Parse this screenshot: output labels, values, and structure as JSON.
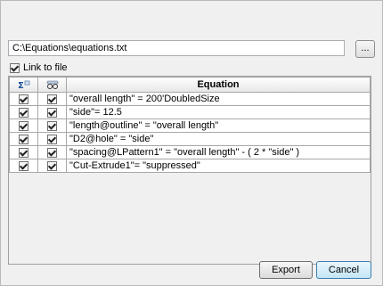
{
  "file": {
    "path": "C:\\Equations\\equations.txt",
    "browse_label": "...",
    "link_label": "Link to file",
    "link_checked": true
  },
  "grid": {
    "col1_icon": "sigma-icon",
    "col2_icon": "glasses-icon",
    "equation_header": "Equation",
    "rows": [
      {
        "equation": "\"overall length\" = 200'DoubledSize",
        "active": true,
        "visible": true
      },
      {
        "equation": "\"side\"= 12.5",
        "active": true,
        "visible": true
      },
      {
        "equation": "\"length@outline\" = \"overall length\"",
        "active": true,
        "visible": true
      },
      {
        "equation": "\"D2@hole\" = \"side\"",
        "active": true,
        "visible": true
      },
      {
        "equation": "\"spacing@LPattern1\" = \"overall length\" - ( 2 * \"side\" )",
        "active": true,
        "visible": true
      },
      {
        "equation": "\"Cut-Extrude1\"= \"suppressed\"",
        "active": true,
        "visible": true
      }
    ]
  },
  "buttons": {
    "export_label": "Export",
    "cancel_label": "Cancel"
  }
}
